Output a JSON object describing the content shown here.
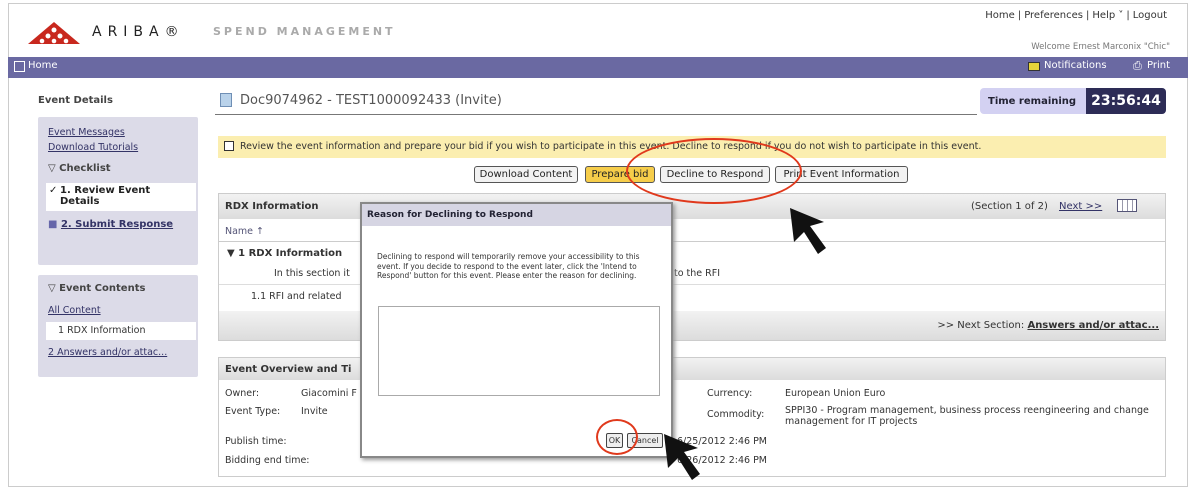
{
  "header": {
    "logo_text": "ARIBA®",
    "product": "SPEND MANAGEMENT",
    "links": [
      "Home",
      "Preferences",
      "Help ˅",
      "Logout"
    ],
    "welcome": "Welcome Ernest Marconix \"Chic\""
  },
  "navbar": {
    "home": "Home",
    "notifications": "Notifications",
    "print": "Print"
  },
  "sidebar": {
    "title": "Event Details",
    "links": [
      "Event Messages",
      "Download Tutorials"
    ],
    "checklist_label": "Checklist",
    "checklist": [
      "1. Review Event Details",
      "2. Submit Response"
    ],
    "contents_label": "Event Contents",
    "contents": [
      "All Content",
      "1  RDX Information",
      "2  Answers and/or attac..."
    ]
  },
  "main": {
    "title": "Doc9074962 - TEST1000092433 (Invite)",
    "time_label": "Time remaining",
    "time_value": "23:56:44",
    "notice": "Review the event information and prepare your bid if you wish to participate in this event.  Decline to respond if you do not wish to participate in this event.",
    "buttons": [
      "Download Content",
      "Prepare bid",
      "Decline to Respond",
      "Print Event Information"
    ],
    "rdx": {
      "title": "RDX Information",
      "section": "(Section 1 of 2)",
      "next": "Next >>",
      "name_col": "Name ↑",
      "group": "▼ 1  RDX Information",
      "desc_start": "In this section it",
      "desc_end": "to the RFI",
      "item": "1.1  RFI and related",
      "next_section_label": ">> Next Section:",
      "next_section_link": "Answers and/or attac..."
    },
    "overview": {
      "title": "Event Overview and Ti",
      "owner_label": "Owner:",
      "owner_value": "Giacomini F",
      "type_label": "Event Type:",
      "type_value": "Invite",
      "publish_label": "Publish time:",
      "publish_value": "6/25/2012 2:46 PM",
      "end_label": "Bidding end time:",
      "end_value": "6/26/2012 2:46 PM",
      "currency_label": "Currency:",
      "currency_value": "European Union Euro",
      "commodity_label": "Commodity:",
      "commodity_value": "SPPI30 - Program management, business process reengineering and change management for IT projects"
    }
  },
  "dialog": {
    "title": "Reason for Declining to Respond",
    "message": "Declining to respond will temporarily remove your accessibility to this event. If you decide to respond to the event later, click the 'Intend to Respond' button for this event. Please enter the reason for declining.",
    "reason_value": "",
    "ok": "OK",
    "cancel": "Cancel"
  }
}
